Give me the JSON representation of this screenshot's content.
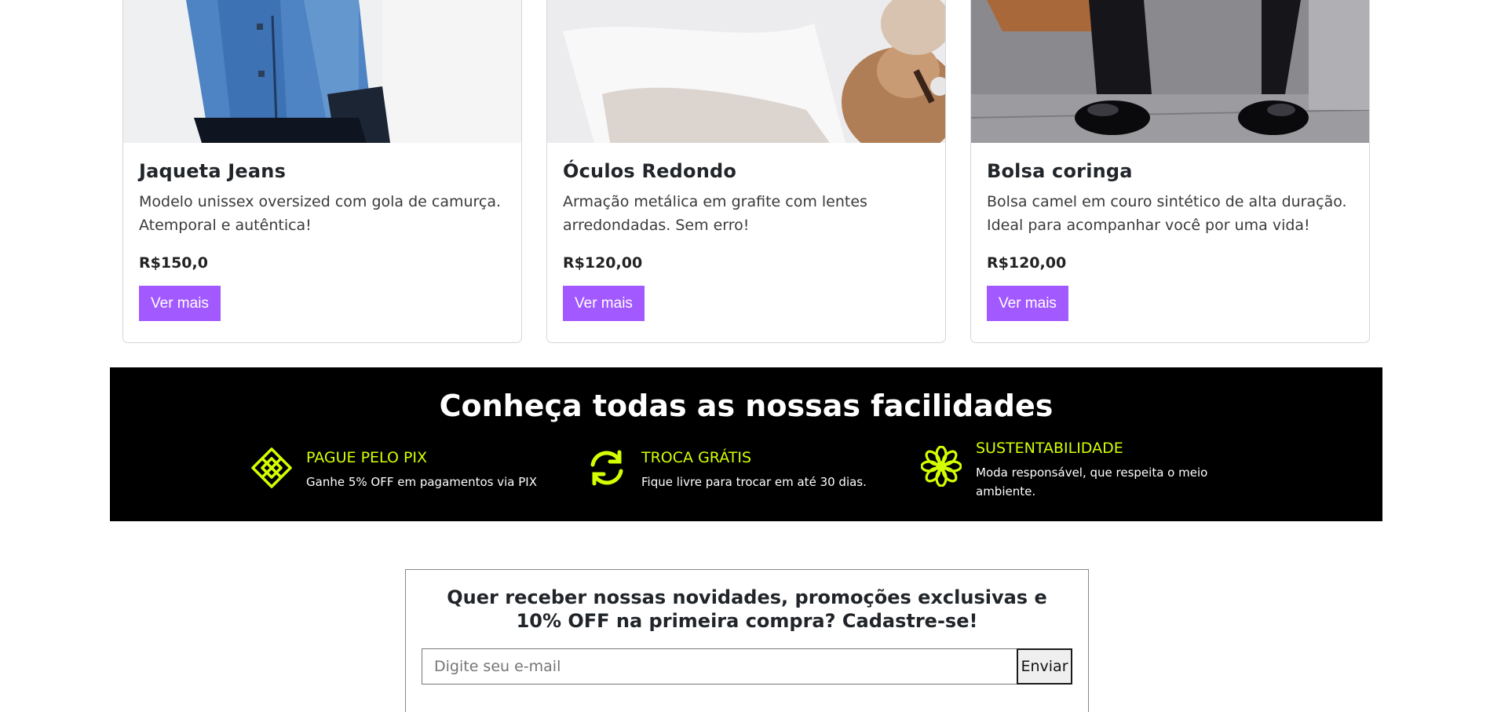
{
  "products": [
    {
      "title": "Jaqueta Jeans",
      "description": "Modelo unissex oversized com gola de camurça. Atemporal e autêntica!",
      "price": "R$150,0",
      "button_label": "Ver mais",
      "image_icon": "denim-jacket-photo"
    },
    {
      "title": "Óculos Redondo",
      "description": "Armação metálica em grafite com lentes arredondadas. Sem erro!",
      "price": "R$120,00",
      "button_label": "Ver mais",
      "image_icon": "round-glasses-photo"
    },
    {
      "title": "Bolsa coringa",
      "description": "Bolsa camel em couro sintético de alta duração. Ideal para acompanhar você por uma vida!",
      "price": "R$120,00",
      "button_label": "Ver mais",
      "image_icon": "camel-bag-photo"
    }
  ],
  "facilities": {
    "title": "Conheça todas as nossas facilidades",
    "items": [
      {
        "icon": "pix-icon",
        "title": "PAGUE PELO PIX",
        "description": "Ganhe 5% OFF em pagamentos via PIX"
      },
      {
        "icon": "exchange-icon",
        "title": "TROCA GRÁTIS",
        "description": "Fique livre para trocar em até 30 dias."
      },
      {
        "icon": "flower-icon",
        "title": "SUSTENTABILIDADE",
        "description": "Moda responsável, que respeita o meio ambiente."
      }
    ]
  },
  "newsletter": {
    "title": "Quer receber nossas novidades, promoções exclusivas e 10% OFF na primeira compra? Cadastre-se!",
    "email_placeholder": "Digite seu e-mail",
    "email_value": "",
    "submit_label": "Enviar"
  },
  "colors": {
    "button_purple": "#a259ff",
    "accent_lime": "#d4ff00",
    "band_background": "#000000"
  }
}
